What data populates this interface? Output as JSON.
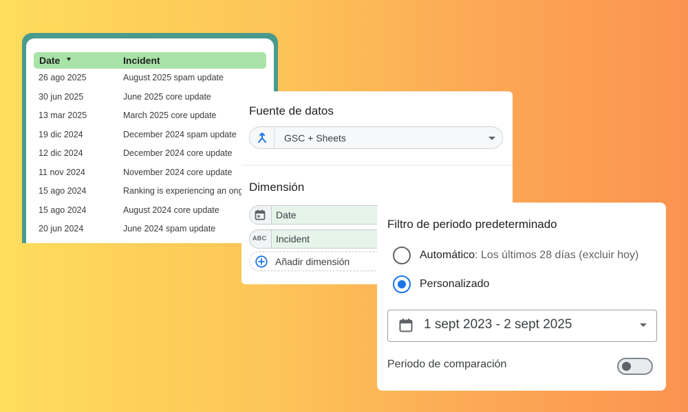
{
  "incidents_table": {
    "headers": {
      "date": "Date",
      "incident": "Incident"
    },
    "sort": "descending",
    "rows": [
      {
        "date": "26 ago 2025",
        "incident": "August 2025 spam update"
      },
      {
        "date": "30 jun 2025",
        "incident": "June 2025 core update"
      },
      {
        "date": "13 mar 2025",
        "incident": "March 2025 core update"
      },
      {
        "date": "19 dic 2024",
        "incident": "December 2024 spam update"
      },
      {
        "date": "12 dic 2024",
        "incident": "December 2024 core update"
      },
      {
        "date": "11 nov 2024",
        "incident": "November 2024 core update"
      },
      {
        "date": "15 ago 2024",
        "incident": "Ranking is experiencing an ongoing issue"
      },
      {
        "date": "15 ago 2024",
        "incident": "August 2024 core update"
      },
      {
        "date": "20 jun 2024",
        "incident": "June 2024 spam update"
      }
    ]
  },
  "data_source": {
    "title": "Fuente de datos",
    "selected": "GSC + Sheets",
    "icon": "blend-icon",
    "dimension_title": "Dimensión",
    "dimensions": [
      {
        "label": "Date",
        "icon": "calendar-icon"
      },
      {
        "label": "Incident",
        "icon_text": "ABC"
      }
    ],
    "add_dimension_label": "Añadir dimensión"
  },
  "date_filter": {
    "title": "Filtro de periodo predeterminado",
    "options": [
      {
        "label": "Automático",
        "description": ": Los últimos 28 días (excluir hoy)",
        "selected": false
      },
      {
        "label": "Personalizado",
        "selected": true
      }
    ],
    "range": "1 sept 2023 - 2 sept 2025",
    "comparison_label": "Periodo de comparación",
    "comparison_enabled": false
  },
  "colors": {
    "accent": "#1a73e8",
    "table_header": "#a8e4a8",
    "table_frame": "#4a9a8e",
    "chip": "#e6f4ea"
  }
}
